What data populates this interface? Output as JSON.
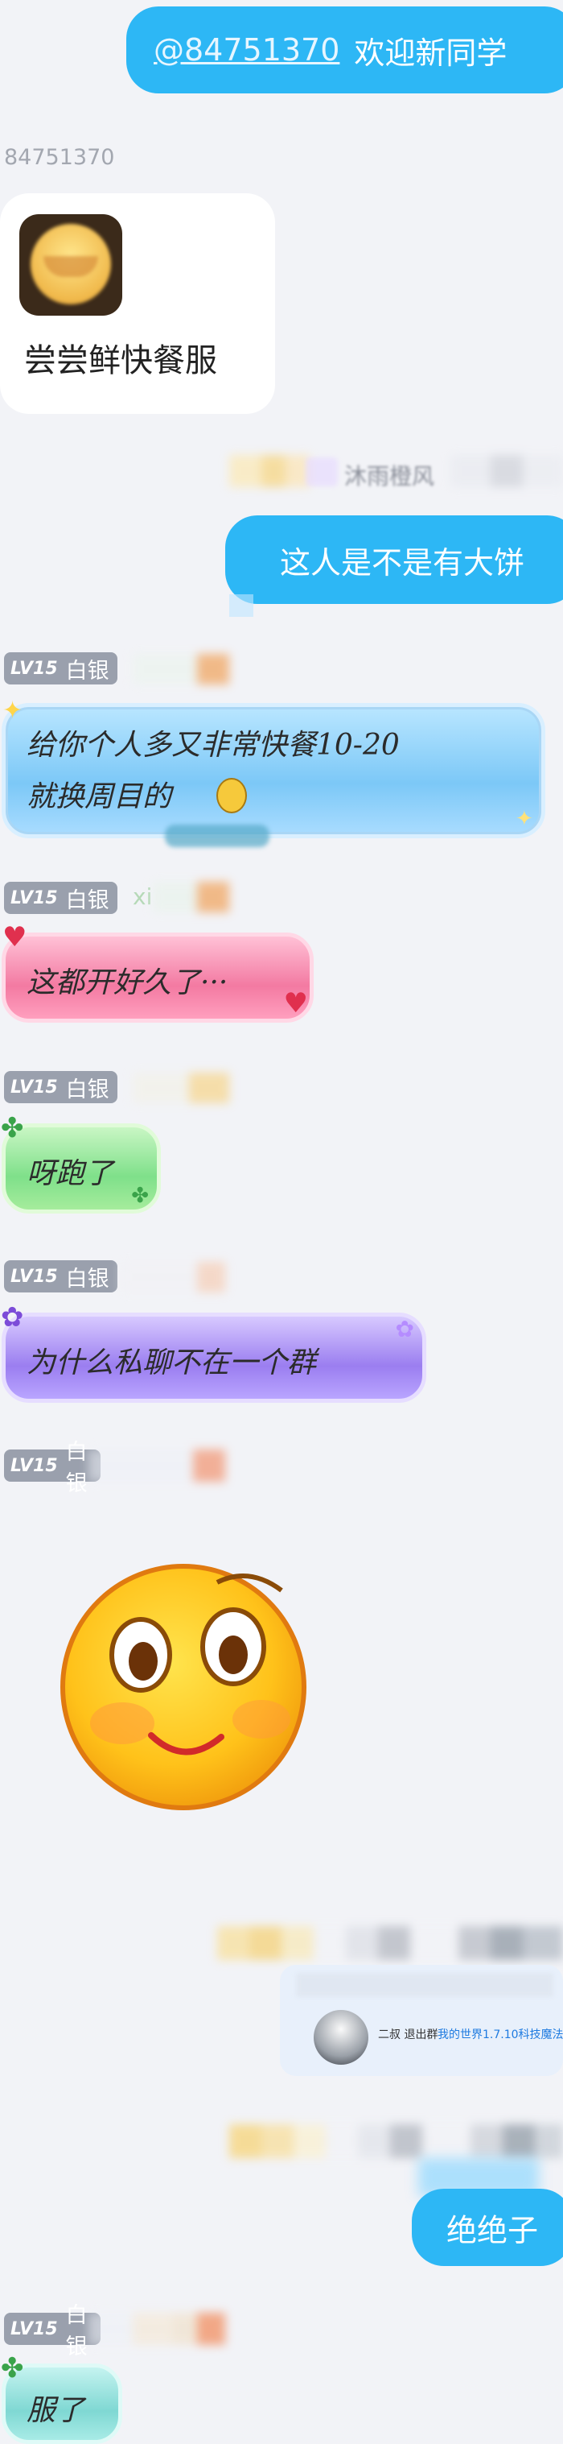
{
  "top_message": {
    "at": "@84751370",
    "text": "欢迎新同学"
  },
  "sender_id": "84751370",
  "sticker_card": {
    "caption": "尝尝鲜快餐服"
  },
  "owner": {
    "name": "沐雨橙风"
  },
  "my_message_1": "这人是不是有大饼",
  "level_tag": {
    "lv": "LV15",
    "rank": "白银"
  },
  "xi_name": "xi",
  "messages": {
    "m1_line1": "给你个人多又非常快餐10-20",
    "m1_line2": "就换周目的",
    "m2": "这都开好久了···",
    "m3": "呀跑了",
    "m4": "为什么私聊不在一个群"
  },
  "share_card": {
    "prefix": "二叔 退出群",
    "link": "我的世界1.7.10科技魔法"
  },
  "my_message_2": "绝绝子",
  "last_message": "服了",
  "colors": {
    "blue": "#2db7f5",
    "bubble_lightblue": "#8fd3ff",
    "bubble_pink": "#f37aa2",
    "bubble_green": "#7fe08a",
    "bubble_purple": "#9b7ef0",
    "page_bg": "#f2f3f7"
  }
}
